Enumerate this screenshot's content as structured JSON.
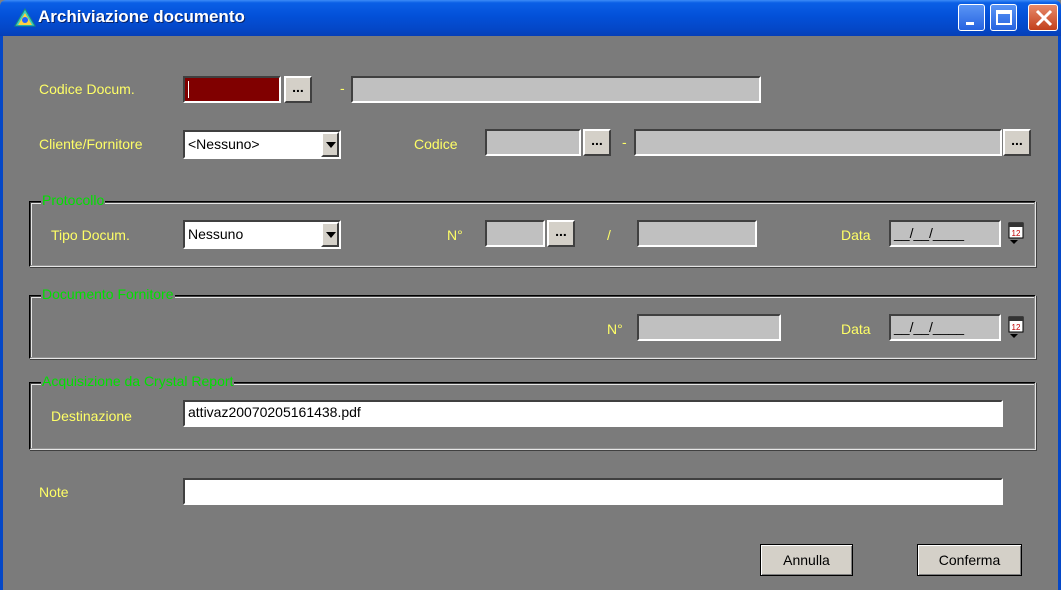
{
  "window": {
    "title": "Archiviazione documento"
  },
  "fields": {
    "codice_docum_label": "Codice Docum.",
    "codice_docum_separator": "-",
    "cliente_fornitore_label": "Cliente/Fornitore",
    "cliente_fornitore_value": "<Nessuno>",
    "codice_label": "Codice",
    "codice_separator": "-"
  },
  "protocollo": {
    "title": "Protocollo",
    "tipo_docum_label": "Tipo Docum.",
    "tipo_docum_value": "Nessuno",
    "numero_label": "N°",
    "slash": "/",
    "data_label": "Data",
    "data_value": "__/__/____"
  },
  "documento_fornitore": {
    "title": "Documento Fornitore",
    "numero_label": "N°",
    "data_label": "Data",
    "data_value": "__/__/____"
  },
  "crystal": {
    "title": "Acquisizione da Crystal Report",
    "destinazione_label": "Destinazione",
    "destinazione_value": "attivaz20070205161438.pdf"
  },
  "note": {
    "label": "Note",
    "value": ""
  },
  "buttons": {
    "browse": "...",
    "annulla": "Annulla",
    "conferma": "Conferma"
  },
  "colors": {
    "label": "#ffff66",
    "group_title": "#00e000",
    "titlebar": "#0350d8",
    "codice_field": "#800000"
  }
}
